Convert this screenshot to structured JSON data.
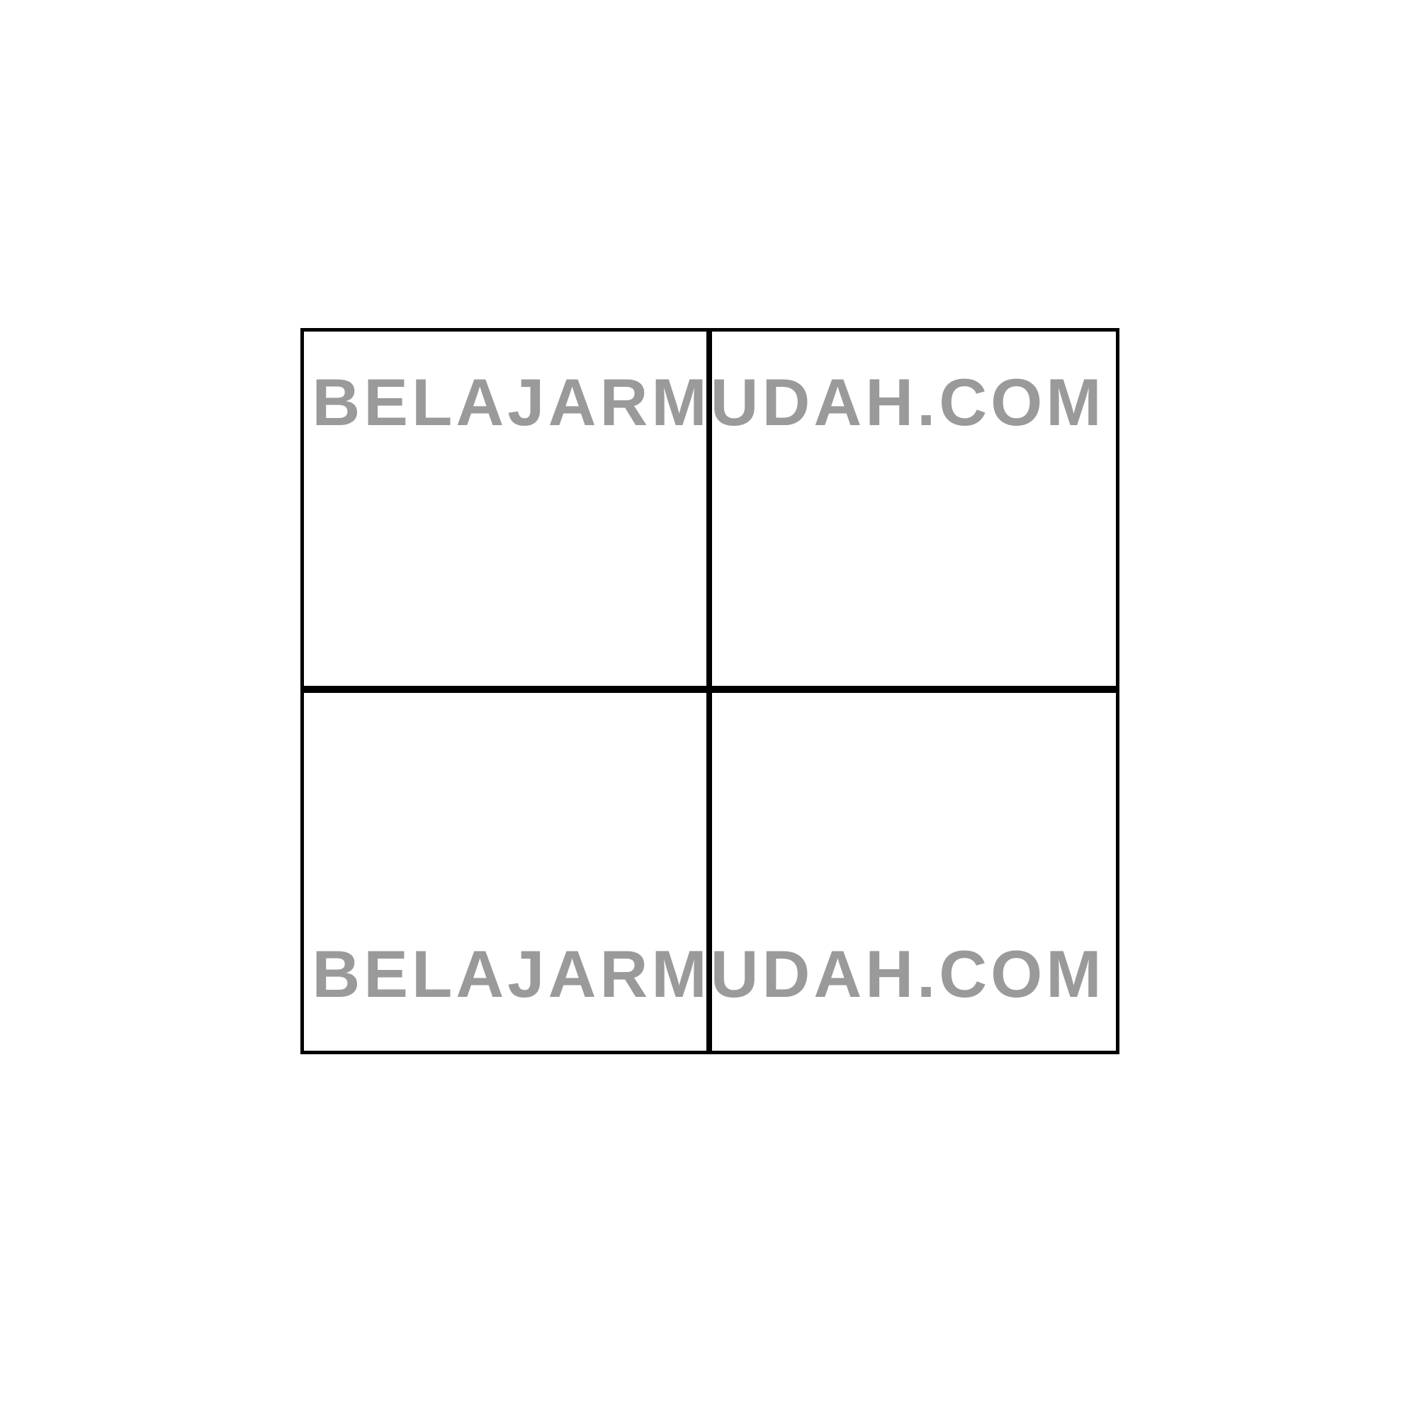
{
  "watermark": {
    "text": "BELAJARMUDAH.COM",
    "color": "#9a9a9a"
  },
  "grid": {
    "rows": 2,
    "columns": 2,
    "line_color": "#000000",
    "cell_fill": "#ffffff"
  }
}
